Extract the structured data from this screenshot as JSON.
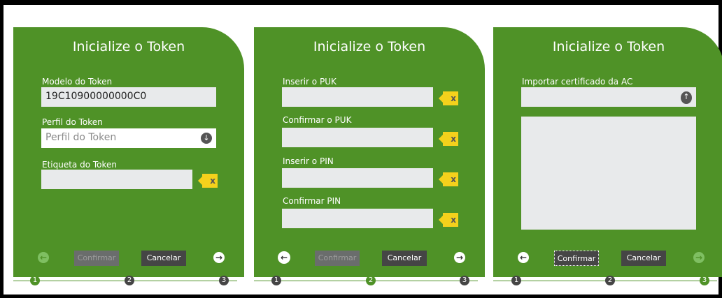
{
  "panels": [
    {
      "title": "Inicialize o Token",
      "model_label": "Modelo do Token",
      "model_value": "19C10900000000C0",
      "profile_label": "Perfil do Token",
      "profile_placeholder": "Perfil do Token",
      "label_label": "Etiqueta do Token",
      "confirm": "Confirmar",
      "cancel": "Cancelar"
    },
    {
      "title": "Inicialize o Token",
      "puk_label": "Inserir o PUK",
      "puk_confirm_label": "Confirmar o PUK",
      "pin_label": "Inserir o PIN",
      "pin_confirm_label": "Confirmar PIN",
      "confirm": "Confirmar",
      "cancel": "Cancelar"
    },
    {
      "title": "Inicialize o Token",
      "import_label": "Importar certificado da AC",
      "confirm": "Confirmar",
      "cancel": "Cancelar"
    }
  ],
  "clear_glyph": "x",
  "steps": [
    "1",
    "2",
    "3"
  ],
  "icons": {
    "prev": "arrow-left-circle-icon",
    "next": "arrow-right-circle-icon",
    "dropdown": "arrow-down-circle-icon",
    "upload": "upload-icon",
    "clear": "clear-x-icon"
  },
  "colors": {
    "panel": "#4f9227",
    "clear": "#f4d11c",
    "field": "#e8eaeb",
    "button": "#454545"
  }
}
